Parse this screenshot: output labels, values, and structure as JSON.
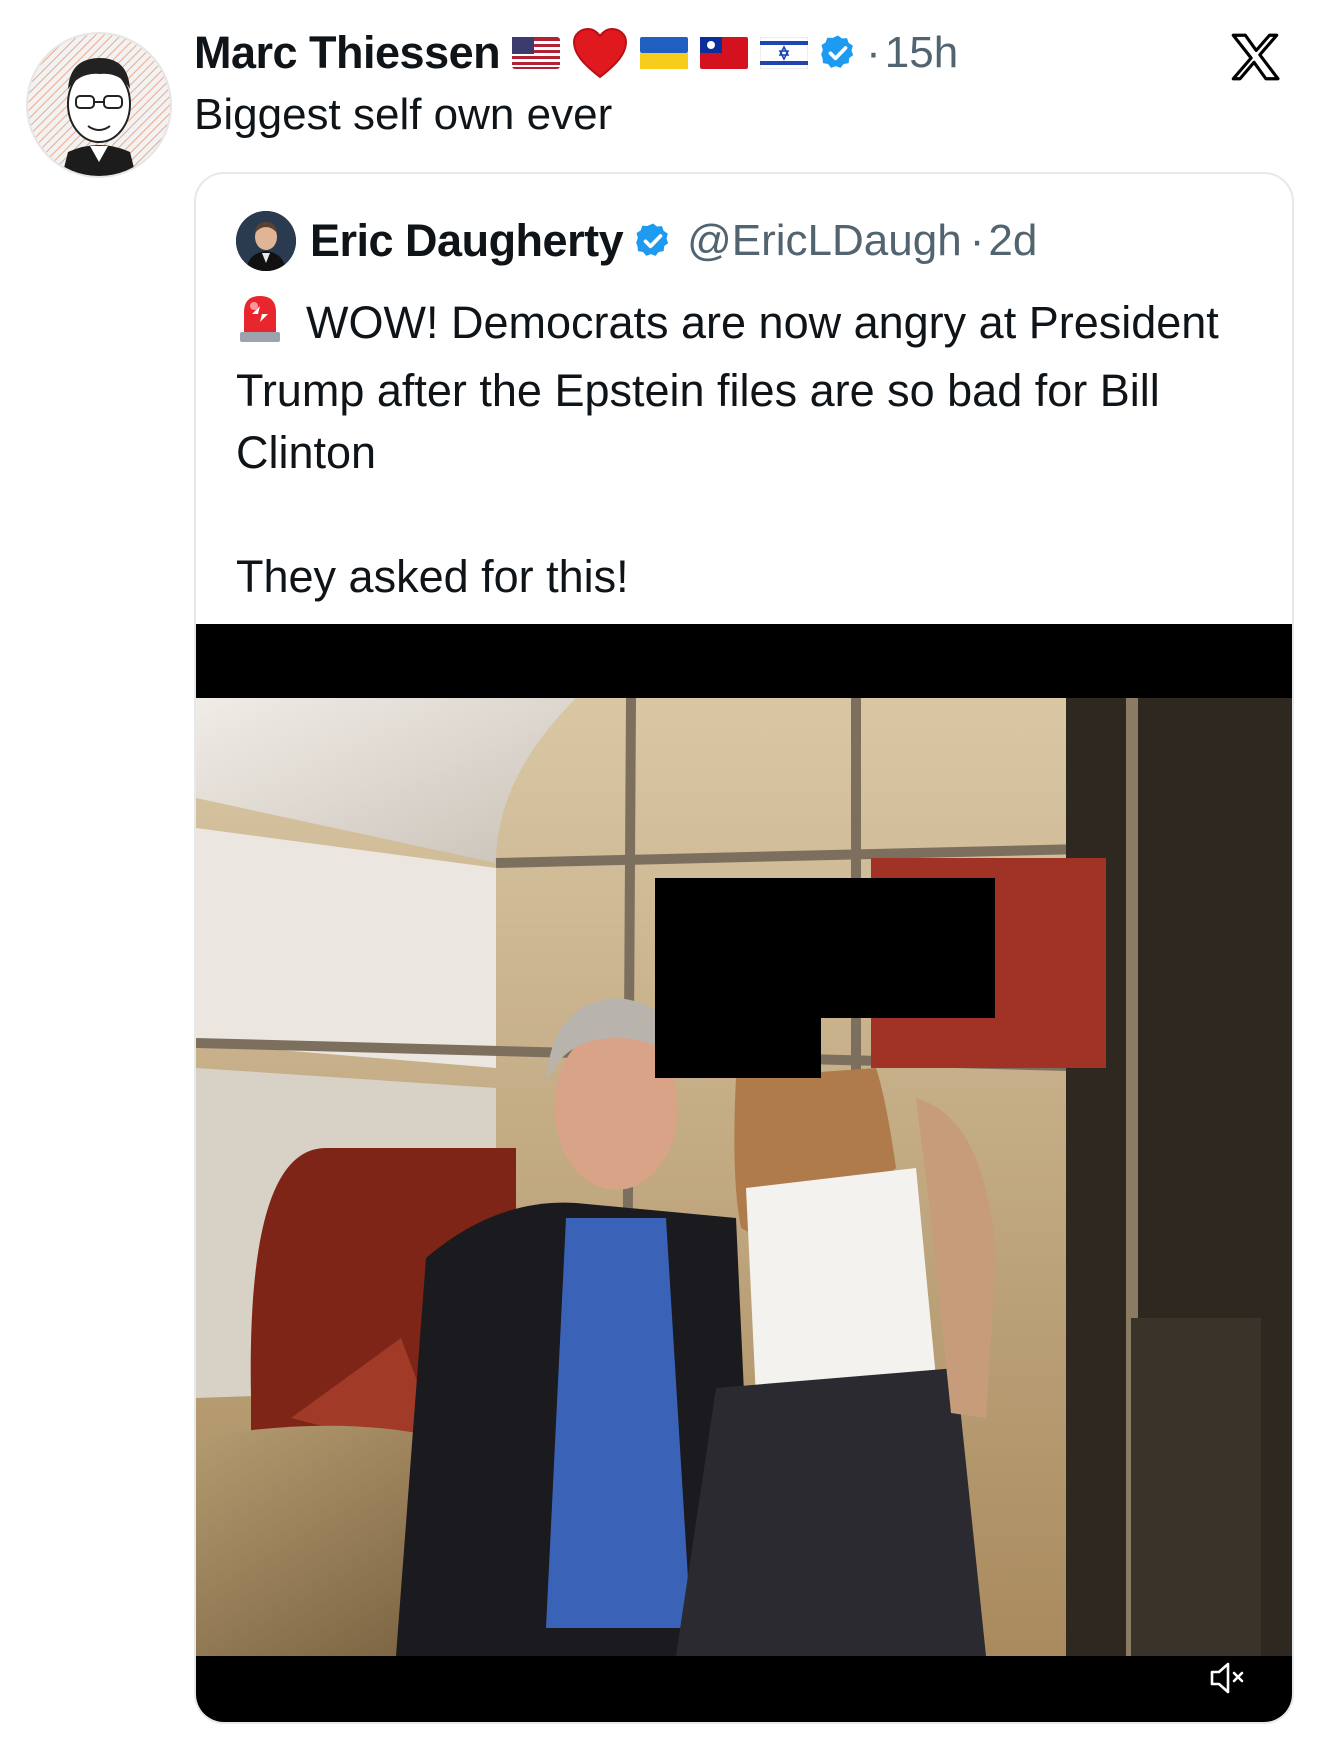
{
  "tweet": {
    "author_name": "Marc Thiessen",
    "time_sep": "·",
    "time": "15h",
    "text": "Biggest self own ever"
  },
  "quoted": {
    "author_name": "Eric Daugherty",
    "handle": "@EricLDaugh",
    "time_sep": "·",
    "time": "2d",
    "line1": "WOW! Democrats are now angry at President Trump after the Epstein files are so bad for Bill Clinton",
    "line2": "They asked for this!"
  },
  "icons": {
    "flags": [
      "us-flag-icon",
      "red-heart-icon",
      "ukraine-flag-icon",
      "taiwan-flag-icon",
      "israel-flag-icon"
    ],
    "verified": "verified-badge-icon",
    "platform": "x-logo-icon",
    "siren": "rotating-light-icon",
    "mute": "muted-speaker-icon"
  },
  "colors": {
    "verified_blue": "#1d9bf0",
    "secondary_text": "#536471",
    "redaction": "#000000"
  }
}
